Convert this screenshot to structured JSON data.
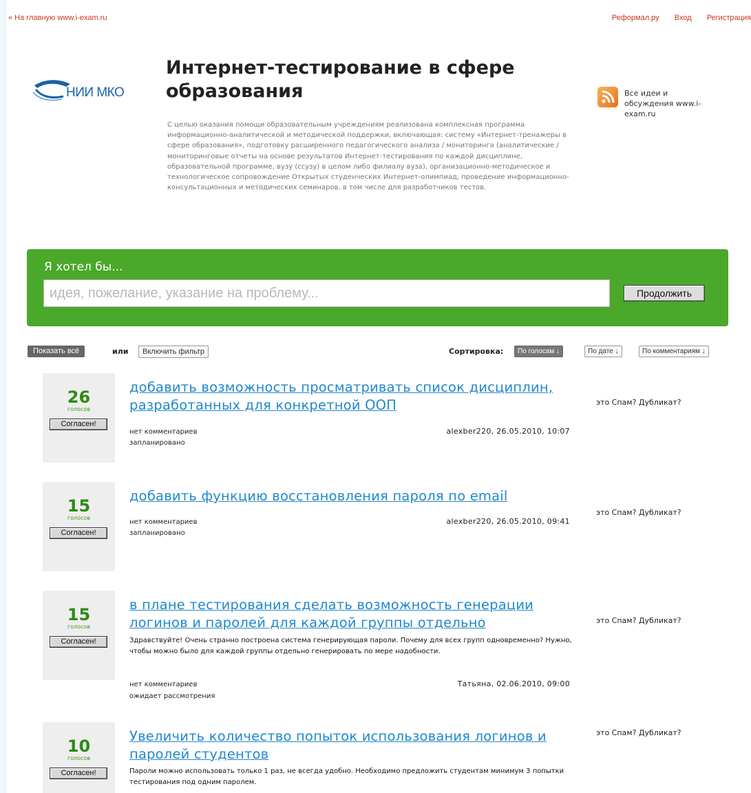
{
  "topbar": {
    "home_link": "« На главную www.i-exam.ru",
    "reformal_link": "Реформал.ру",
    "login_link": "Вход",
    "register_link": "Регистрация"
  },
  "header": {
    "logo_text": "НИИ МКО",
    "title": "Интернет-тестирование в сфере образования",
    "description": "С целью оказания помощи образовательным учреждениям реализована комплексная программа информационно-аналитической и методической поддержки, включающая: систему «Интернет-тренажеры в сфере образования», подготовку расширенного педагогического анализа / мониторинга (аналитические / мониторинговые отчеты на основе результатов Интернет-тестирования по каждой дисциплине, образовательной программе, вузу (ссузу) в целом либо филиалу вуза), организационно-методическое и технологическое сопровождение Открытых студенческих Интернет-олимпиад, проведение информационно-консультационных и методических семинаров, в том числе для разработчиков тестов.",
    "rss_text": "Все идеи и обсуждения www.i-exam.ru"
  },
  "idea_form": {
    "label": "Я хотел бы...",
    "placeholder": "идея, пожелание, указание на проблему...",
    "value": "",
    "submit_label": "Продолжить"
  },
  "filters": {
    "show_all_label": "Показать всё",
    "or_label": "или",
    "filter_label": "Включить фильтр",
    "sort_label": "Сортировка:",
    "sort_by_votes": "По голосам ↓",
    "sort_by_date": "По дате ↓",
    "sort_by_comments": "По комментариям ↓"
  },
  "ideas": [
    {
      "votes": "26",
      "votes_label": "голосов",
      "agree_label": "Согласен!",
      "title": "добавить возможность просматривать список дисциплин, разработанных для конкретной ООП",
      "body": "",
      "comments": "нет комментариев",
      "status": "запланировано",
      "author": "alexber220, 26.05.2010, 10:07",
      "spam_links": "это Спам? Дубликат?"
    },
    {
      "votes": "15",
      "votes_label": "голосов",
      "agree_label": "Согласен!",
      "title": "добавить функцию восстановления пароля по email",
      "body": "",
      "comments": "нет комментариев",
      "status": "запланировано",
      "author": "alexber220, 26.05.2010, 09:41",
      "spam_links": "это Спам? Дубликат?"
    },
    {
      "votes": "15",
      "votes_label": "голосов",
      "agree_label": "Согласен!",
      "title": "в плане тестирования сделать возможность генерации логинов и паролей для каждой группы отдельно",
      "body": "Здравствуйте! Очень странно построена система генерирующая пароли. Почему для всех групп одновременно? Нужно, чтобы можно было для каждой группы отдельно генерировать по мере надобности.",
      "comments": "нет комментариев",
      "status": "ожидает рассмотрения",
      "author": "Татьяна, 02.06.2010, 09:00",
      "spam_links": "это Спам? Дубликат?"
    },
    {
      "votes": "10",
      "votes_label": "голосов",
      "agree_label": "Согласен!",
      "title": "Увеличить количество попыток использования логинов и паролей студентов",
      "body": "Пароли можно использовать только 1 раз, не всегда удобно. Необходимо предложить студентам минимум 3 попытки тестирования под одним паролем.",
      "comments": "",
      "status": "",
      "author": "",
      "spam_links": "это Спам? Дубликат?"
    }
  ],
  "colors": {
    "accent_green": "#4aa82a",
    "link_blue": "#2288cc",
    "vote_green": "#2e8a16",
    "top_link_red": "#c8381e"
  }
}
